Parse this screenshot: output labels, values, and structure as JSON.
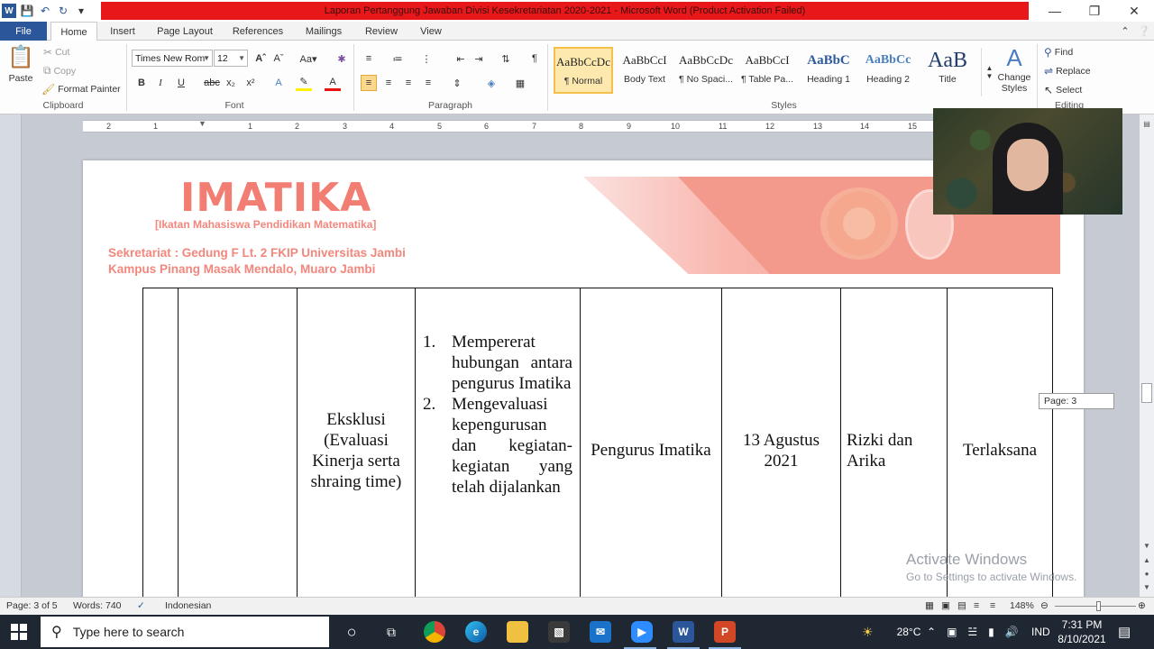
{
  "window": {
    "title": "Laporan Pertanggung Jawaban Divisi Kesekretariatan 2020-2021  -  Microsoft Word (Product Activation Failed)",
    "title_bar_color": "#e8181a"
  },
  "qat": {
    "icons": [
      "word-icon",
      "save-icon",
      "undo-icon",
      "redo-icon",
      "customize-icon"
    ]
  },
  "ribbon_tabs": [
    "File",
    "Home",
    "Insert",
    "Page Layout",
    "References",
    "Mailings",
    "Review",
    "View"
  ],
  "active_tab": "Home",
  "clipboard": {
    "paste": "Paste",
    "cut": "Cut",
    "copy": "Copy",
    "format_painter": "Format Painter",
    "label": "Clipboard"
  },
  "font": {
    "name": "Times New Rom",
    "size": "12",
    "label": "Font"
  },
  "paragraph": {
    "label": "Paragraph"
  },
  "styles": {
    "label": "Styles",
    "items": [
      {
        "preview": "AaBbCcDc",
        "name": "¶ Normal"
      },
      {
        "preview": "AaBbCcI",
        "name": "Body Text"
      },
      {
        "preview": "AaBbCcDc",
        "name": "¶ No Spaci..."
      },
      {
        "preview": "AaBbCcI",
        "name": "¶ Table Pa..."
      },
      {
        "preview": "AaBbC",
        "name": "Heading 1"
      },
      {
        "preview": "AaBbCc",
        "name": "Heading 2"
      },
      {
        "preview": "AaB",
        "name": "Title"
      }
    ],
    "change_styles": "Change Styles"
  },
  "editing": {
    "find": "Find",
    "replace": "Replace",
    "select": "Select",
    "label": "Editing"
  },
  "ruler_numbers": [
    "2",
    "1",
    "1",
    "2",
    "3",
    "4",
    "5",
    "6",
    "7",
    "8",
    "9",
    "10",
    "11",
    "12",
    "13",
    "14",
    "15"
  ],
  "letterhead": {
    "brand": "IMATIKA",
    "subtitle": "[Ikatan Mahasiswa Pendidikan Matematika]",
    "address1": "Sekretariat : Gedung F Lt. 2 FKIP Universitas Jambi",
    "address2": "Kampus Pinang Masak Mendalo, Muaro Jambi",
    "accent": "#f27d73"
  },
  "table": {
    "activity": "Eksklusi (Evaluasi Kinerja serta shraing time)",
    "goals": [
      {
        "num": "1.",
        "text": "Mempererat hubungan antara pengurus Imatika"
      },
      {
        "num": "2.",
        "text": "Mengevaluasi kepengurusan dan kegiatan-kegiatan yang telah dijalankan"
      }
    ],
    "participants": "Pengurus Imatika",
    "date": "13 Agustus 2021",
    "pic": "Rizki dan Arika",
    "status": "Terlaksana"
  },
  "page_tooltip": "Page: 3",
  "watermark": {
    "line1": "Activate Windows",
    "line2": "Go to Settings to activate Windows."
  },
  "status": {
    "page": "Page: 3 of 5",
    "words": "Words: 740",
    "language": "Indonesian",
    "zoom": "148%"
  },
  "taskbar": {
    "search_placeholder": "Type here to search",
    "weather": "28°C",
    "lang": "IND",
    "time": "7:31 PM",
    "date": "8/10/2021"
  }
}
